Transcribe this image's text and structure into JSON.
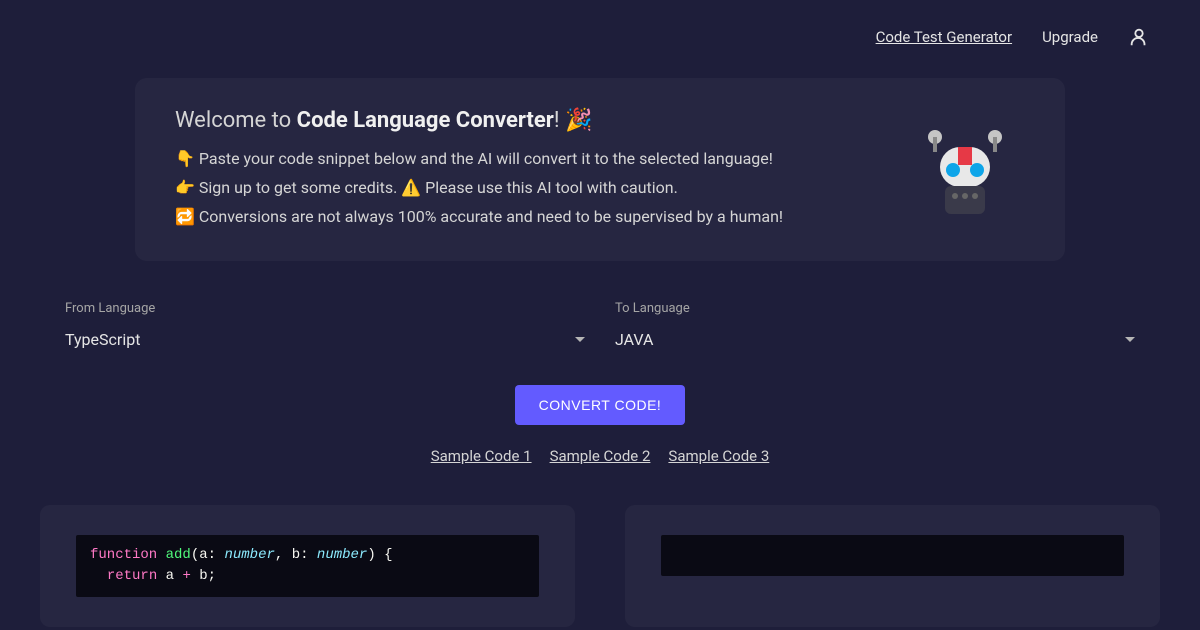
{
  "header": {
    "link_test_generator": "Code Test Generator",
    "link_upgrade": "Upgrade"
  },
  "welcome": {
    "prefix": "Welcome to ",
    "title": "Code Language Converter",
    "suffix": "! 🎉",
    "line1": "👇 Paste your code snippet below and the AI will convert it to the selected language!",
    "line2": "👉 Sign up to get some credits.  ⚠️ Please use this AI tool with caution.",
    "line3": "🔁 Conversions are not always 100% accurate and need to be supervised by a human!"
  },
  "from": {
    "label": "From Language",
    "value": "TypeScript"
  },
  "to": {
    "label": "To Language",
    "value": "JAVA"
  },
  "convert": {
    "label": "CONVERT CODE!"
  },
  "samples": {
    "s1": "Sample Code 1",
    "s2": "Sample Code 2",
    "s3": "Sample Code 3"
  },
  "code": {
    "kw_function": "function",
    "fn_name": "add",
    "var_a": "a",
    "type_number": "number",
    "var_b": "b",
    "kw_return": "return",
    "op_plus": "+"
  }
}
